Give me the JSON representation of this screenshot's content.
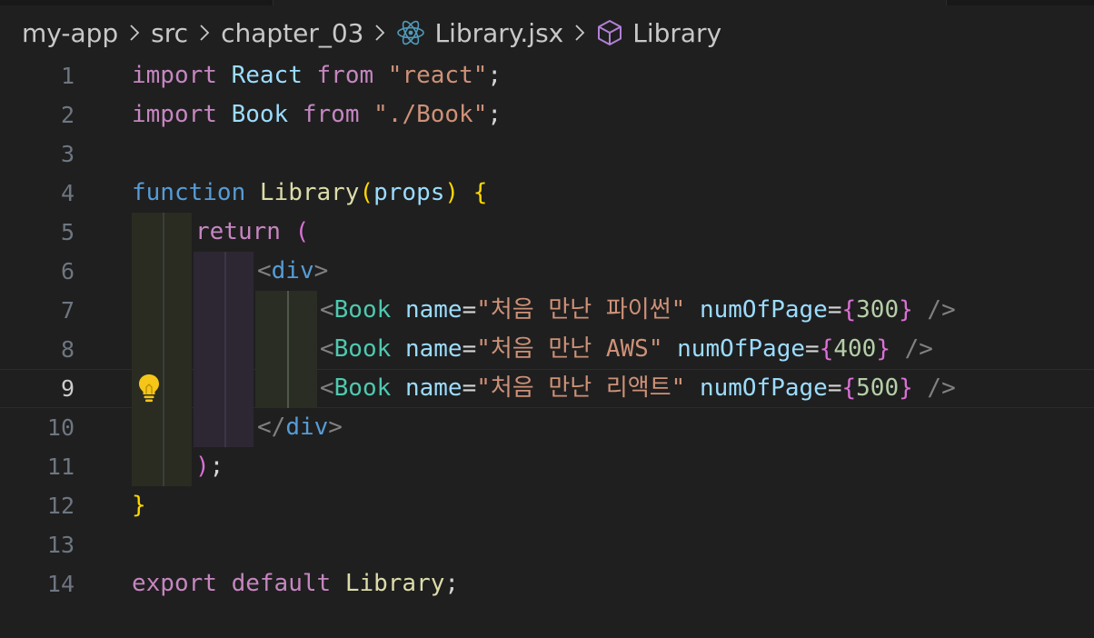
{
  "breadcrumb": {
    "items": [
      "my-app",
      "src",
      "chapter_03",
      "Library.jsx",
      "Library"
    ],
    "separator_icon": "chevron-right-icon",
    "file_icon": "react-icon",
    "symbol_icon": "symbol-cube-icon"
  },
  "editor": {
    "language": "javascriptreact",
    "current_line": 9,
    "line_numbers": [
      "1",
      "2",
      "3",
      "4",
      "5",
      "6",
      "7",
      "8",
      "9",
      "10",
      "11",
      "12",
      "13",
      "14"
    ],
    "lines": [
      "import React from \"react\";",
      "import Book from \"./Book\";",
      "",
      "function Library(props) {",
      "    return (",
      "        <div>",
      "            <Book name=\"처음 만난 파이썬\" numOfPage={300} />",
      "            <Book name=\"처음 만난 AWS\" numOfPage={400} />",
      "            <Book name=\"처음 만난 리액트\" numOfPage={500} />",
      "        </div>",
      "    );",
      "}",
      "",
      "export default Library;"
    ],
    "lightbulb_icon": "lightbulb-icon"
  },
  "colors": {
    "background": "#1f1f1f",
    "keyword": "#c586c0",
    "function_keyword": "#569cd6",
    "identifier": "#9cdcfe",
    "function_name": "#dcdcaa",
    "string": "#ce9178",
    "component": "#4ec9b0",
    "number": "#b5cea8",
    "bracket_gold": "#ffd700",
    "bracket_orchid": "#da70d6",
    "lightbulb": "#f5c518"
  }
}
